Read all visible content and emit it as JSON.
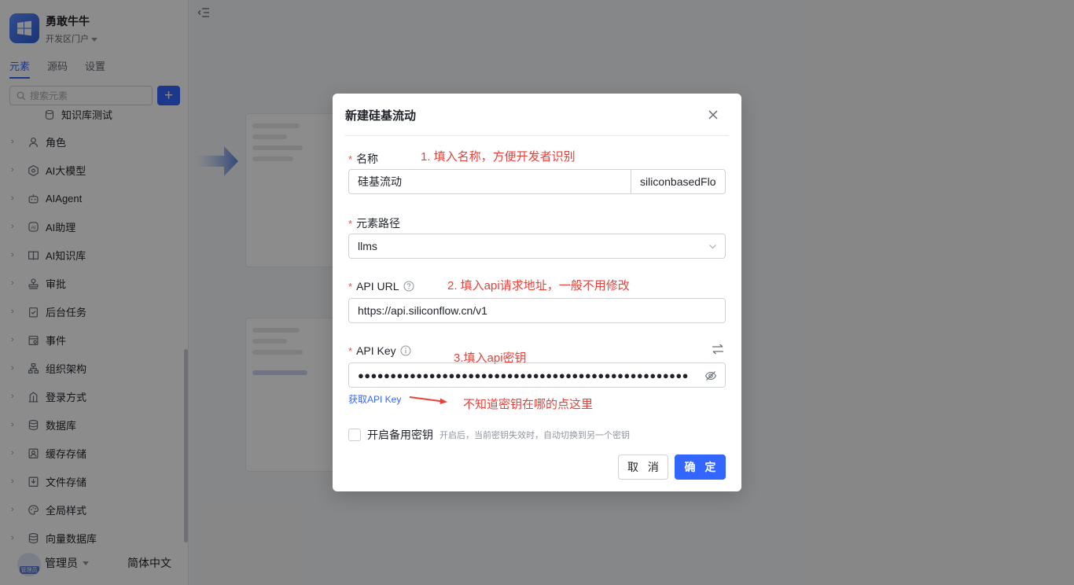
{
  "app": {
    "name": "勇敢牛牛",
    "portal": "开发区门户"
  },
  "sidebar": {
    "tabs": [
      {
        "label": "元素",
        "active": true
      },
      {
        "label": "源码",
        "active": false
      },
      {
        "label": "设置",
        "active": false
      }
    ],
    "search_placeholder": "搜索元素",
    "add_label": "+",
    "sub_item": "知识库测试",
    "items": [
      {
        "label": "角色",
        "icon": "role-icon"
      },
      {
        "label": "AI大模型",
        "icon": "ai-model-icon"
      },
      {
        "label": "AIAgent",
        "icon": "robot-icon"
      },
      {
        "label": "AI助理",
        "icon": "ai-assistant-icon"
      },
      {
        "label": "AI知识库",
        "icon": "book-icon"
      },
      {
        "label": "审批",
        "icon": "stamp-icon"
      },
      {
        "label": "后台任务",
        "icon": "task-icon"
      },
      {
        "label": "事件",
        "icon": "event-icon"
      },
      {
        "label": "组织架构",
        "icon": "org-icon"
      },
      {
        "label": "登录方式",
        "icon": "login-icon"
      },
      {
        "label": "数据库",
        "icon": "database-icon"
      },
      {
        "label": "缓存存储",
        "icon": "cache-icon"
      },
      {
        "label": "文件存储",
        "icon": "file-storage-icon"
      },
      {
        "label": "全局样式",
        "icon": "palette-icon"
      },
      {
        "label": "向量数据库",
        "icon": "vector-db-icon"
      }
    ],
    "footer": {
      "avatar_tag": "管理员",
      "user": "管理员",
      "language": "简体中文"
    }
  },
  "modal": {
    "title": "新建硅基流动",
    "name": {
      "label": "名称",
      "value": "硅基流动",
      "code": "siliconbasedFlo",
      "annotation": "1. 填入名称，方便开发者识别"
    },
    "path": {
      "label": "元素路径",
      "value": "llms"
    },
    "api_url": {
      "label": "API URL",
      "value": "https://api.siliconflow.cn/v1",
      "annotation": "2. 填入api请求地址，一般不用修改"
    },
    "api_key": {
      "label": "API Key",
      "value": "●●●●●●●●●●●●●●●●●●●●●●●●●●●●●●●●●●●●●●●●●●●●●●●●●●●",
      "annotation": "3.填入api密钥"
    },
    "get_key_link": "获取API Key",
    "get_key_annotation": "不知道密钥在哪的点这里",
    "backup_key": {
      "label": "开启备用密钥",
      "hint": "开启后，当前密钥失效时，自动切换到另一个密钥",
      "checked": false
    },
    "cancel_label": "取 消",
    "ok_label": "确 定"
  },
  "colors": {
    "primary": "#3366ff",
    "annotation_red": "#e8413a",
    "required": "#f54a45"
  }
}
